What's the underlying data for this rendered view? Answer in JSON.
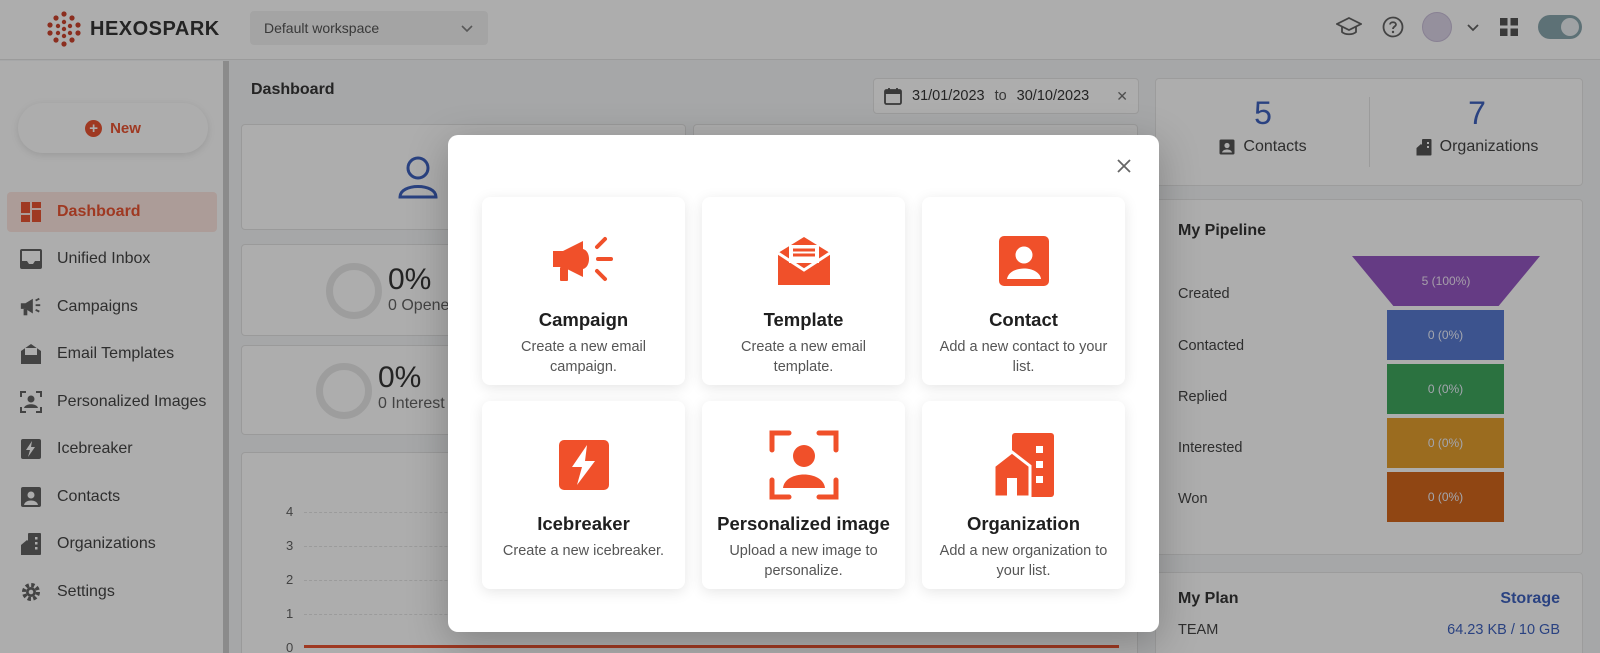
{
  "brand": {
    "name": "HEXOSPARK",
    "accent": "#e8441f"
  },
  "workspace": {
    "selected": "Default workspace"
  },
  "sidebar": {
    "new_label": "New",
    "items": [
      {
        "label": "Dashboard",
        "icon": "dashboard-icon",
        "active": true
      },
      {
        "label": "Unified Inbox",
        "icon": "inbox-icon"
      },
      {
        "label": "Campaigns",
        "icon": "megaphone-icon"
      },
      {
        "label": "Email Templates",
        "icon": "email-template-icon"
      },
      {
        "label": "Personalized Images",
        "icon": "personalized-image-icon"
      },
      {
        "label": "Icebreaker",
        "icon": "icebreaker-icon"
      },
      {
        "label": "Contacts",
        "icon": "contact-icon"
      },
      {
        "label": "Organizations",
        "icon": "organization-icon"
      },
      {
        "label": "Settings",
        "icon": "gear-icon"
      }
    ]
  },
  "main": {
    "title": "Dashboard",
    "date_from": "31/01/2023",
    "date_to_label": "to",
    "date_to": "30/10/2023",
    "stats": [
      {
        "value": "0%",
        "label": "0 Opene"
      },
      {
        "value": "0%",
        "label": "0 Interest"
      }
    ],
    "chart_y_ticks": [
      "4",
      "3",
      "2",
      "1",
      "0"
    ]
  },
  "counts": {
    "contacts_value": "5",
    "contacts_label": "Contacts",
    "organizations_value": "7",
    "organizations_label": "Organizations"
  },
  "pipeline": {
    "title": "My Pipeline",
    "stages": [
      {
        "label": "Created",
        "value": "5 (100%)",
        "color": "#8c47bd"
      },
      {
        "label": "Contacted",
        "value": "0 (0%)",
        "color": "#4a6fce"
      },
      {
        "label": "Replied",
        "value": "0 (0%)",
        "color": "#2ea04f"
      },
      {
        "label": "Interested",
        "value": "0 (0%)",
        "color": "#e3961b"
      },
      {
        "label": "Won",
        "value": "0 (0%)",
        "color": "#d15a07"
      }
    ]
  },
  "plan": {
    "title": "My Plan",
    "storage_label": "Storage",
    "tier": "TEAM",
    "usage": "64.23 KB / 10 GB"
  },
  "modal": {
    "tiles": [
      {
        "title": "Campaign",
        "desc": "Create a new email campaign.",
        "icon": "megaphone-icon"
      },
      {
        "title": "Template",
        "desc": "Create a new email template.",
        "icon": "email-template-icon"
      },
      {
        "title": "Contact",
        "desc": "Add a new contact to your list.",
        "icon": "contact-icon"
      },
      {
        "title": "Icebreaker",
        "desc": "Create a new icebreaker.",
        "icon": "icebreaker-icon"
      },
      {
        "title": "Personalized image",
        "desc": "Upload a new image to personalize.",
        "icon": "personalized-image-icon"
      },
      {
        "title": "Organization",
        "desc": "Add a new organization to your list.",
        "icon": "organization-icon"
      }
    ]
  }
}
